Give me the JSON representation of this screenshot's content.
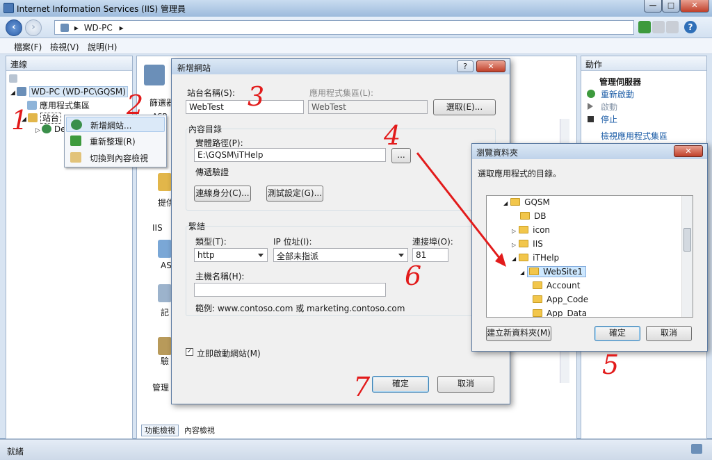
{
  "window": {
    "title": "Internet Information Services (IIS) 管理員",
    "min": "—",
    "max": "□",
    "close": "✕"
  },
  "address": {
    "path": [
      "WD-PC"
    ]
  },
  "menu": [
    "檔案(F)",
    "檢視(V)",
    "說明(H)"
  ],
  "connections": {
    "header": "連線",
    "tree": [
      {
        "label": "WD-PC (WD-PC\\GQSM)",
        "level": 0
      },
      {
        "label": "應用程式集區",
        "level": 1
      },
      {
        "label": "站台",
        "level": 1
      },
      {
        "label": "De",
        "level": 2
      }
    ]
  },
  "context_menu": [
    "新增網站...",
    "重新整理(R)",
    "切換到內容檢視"
  ],
  "center": {
    "filter_label": "篩選器",
    "asp_label": "ASP",
    "iis_label": "IIS",
    "manage_label": "管理",
    "side_items": [
      "提供",
      "AS",
      "記",
      "驗"
    ]
  },
  "actions": {
    "header": "動作",
    "group": "管理伺服器",
    "items": [
      "重新啟動",
      "啟動",
      "停止",
      "檢視應用程式集區"
    ]
  },
  "bottom_tabs": [
    "功能檢視",
    "內容檢視"
  ],
  "status": {
    "text": "就緒"
  },
  "add_site": {
    "title": "新增網站",
    "help": "?",
    "site_name_label": "站台名稱(S):",
    "site_name_value": "WebTest",
    "app_pool_label": "應用程式集區(L):",
    "app_pool_value": "WebTest",
    "select_btn": "選取(E)...",
    "content_dir_label": "內容目錄",
    "physical_path_label": "實體路徑(P):",
    "physical_path_value": "E:\\GQSM\\iTHelp",
    "browse_btn": "...",
    "passthrough_label": "傳遞驗證",
    "connect_as_btn": "連線身分(C)...",
    "test_settings_btn": "測試設定(G)...",
    "binding_label": "繫結",
    "type_label": "類型(T):",
    "type_value": "http",
    "ip_label": "IP 位址(I):",
    "ip_value": "全部未指派",
    "port_label": "連接埠(O):",
    "port_value": "81",
    "host_label": "主機名稱(H):",
    "host_value": "",
    "example": "範例: www.contoso.com 或 marketing.contoso.com",
    "start_checkbox": "立即啟動網站(M)",
    "ok": "確定",
    "cancel": "取消"
  },
  "browse": {
    "title": "瀏覽資料夾",
    "prompt": "選取應用程式的目錄。",
    "tree": [
      "GQSM",
      "DB",
      "icon",
      "IIS",
      "iTHelp",
      "WebSite1",
      "Account",
      "App_Code",
      "App_Data"
    ],
    "new_folder_btn": "建立新資料夾(M)",
    "ok": "確定",
    "cancel": "取消"
  },
  "annotations": [
    "1",
    "2",
    "3",
    "4",
    "5",
    "6",
    "7"
  ],
  "colors": {
    "annotation": "#e21b1b",
    "accent": "#1f5fa8",
    "selection": "#cde8ff"
  }
}
